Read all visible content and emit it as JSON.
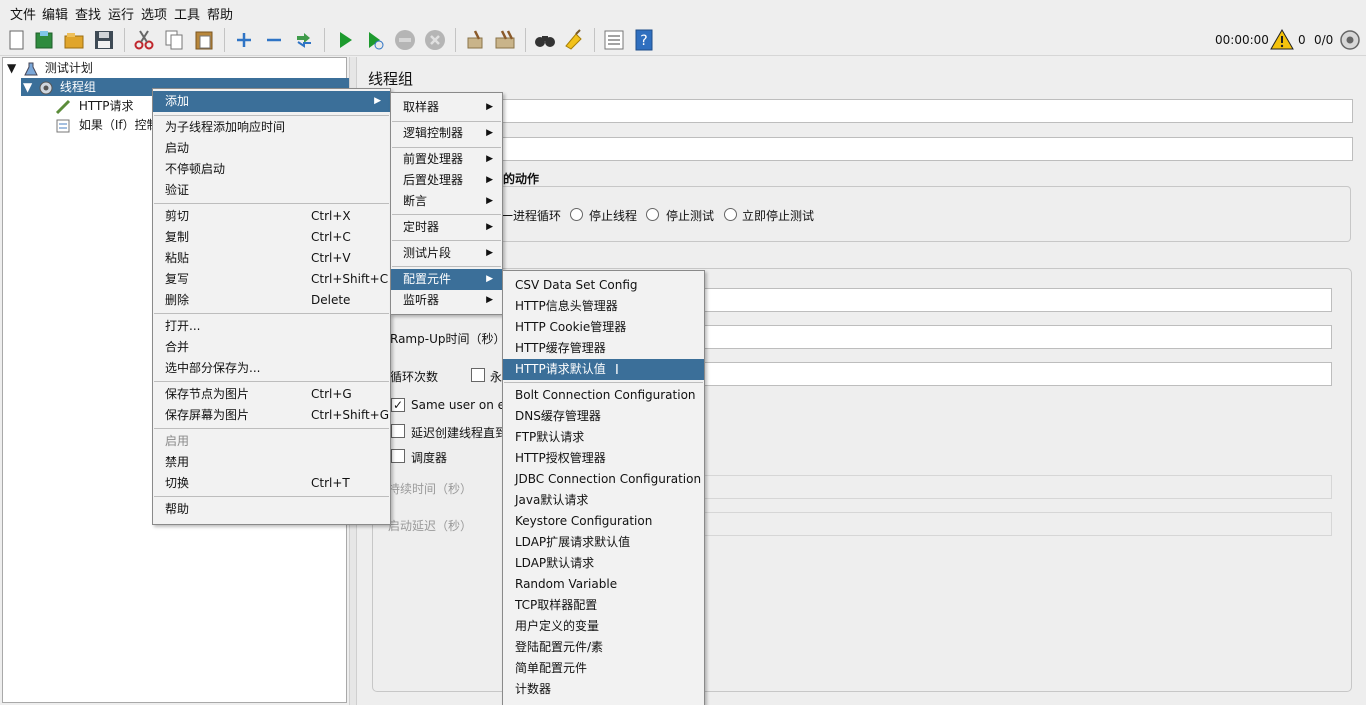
{
  "menubar": [
    "文件",
    "编辑",
    "查找",
    "运行",
    "选项",
    "工具",
    "帮助"
  ],
  "toolbar": {
    "icons": [
      "new-icon",
      "templates-icon",
      "open-icon",
      "save-icon",
      "cut-icon",
      "copy-icon",
      "paste-icon",
      "expand-icon",
      "collapse-icon",
      "toggle-icon",
      "start-icon",
      "start-no-pause-icon",
      "stop-icon",
      "shutdown-icon",
      "clear-icon",
      "clear-all-icon",
      "search-icon",
      "reset-search-icon",
      "function-helper-icon",
      "help-icon"
    ],
    "timer": "00:00:00",
    "warning_count": "0",
    "threads": "0/0",
    "accent": "#3b6f99"
  },
  "tree": {
    "root": "测试计划",
    "thread_group": "线程组",
    "children": [
      "HTTP请求",
      "如果（If）控制"
    ]
  },
  "panel": {
    "title": "线程组",
    "action_label": "的动作",
    "radio_options": [
      "一进程循环",
      "停止线程",
      "停止测试",
      "立即停止测试"
    ],
    "rampup_label": "Ramp-Up时间（秒）",
    "loop_label": "循环次数",
    "forever_label": "永",
    "same_user_label": "Same user on ea",
    "delay_label": "延迟创建线程直到",
    "scheduler_label": "调度器",
    "duration_label": "持续时间（秒）",
    "startup_delay_label": "启动延迟（秒）"
  },
  "context_menu": {
    "items": [
      {
        "label": "添加",
        "submenu": true
      },
      {
        "label": "为子线程添加响应时间"
      },
      {
        "label": "启动"
      },
      {
        "label": "不停顿启动"
      },
      {
        "label": "验证"
      },
      {
        "label": "剪切",
        "shortcut": "Ctrl+X"
      },
      {
        "label": "复制",
        "shortcut": "Ctrl+C"
      },
      {
        "label": "粘贴",
        "shortcut": "Ctrl+V"
      },
      {
        "label": "复写",
        "shortcut": "Ctrl+Shift+C"
      },
      {
        "label": "删除",
        "shortcut": "Delete"
      },
      {
        "label": "打开..."
      },
      {
        "label": "合并"
      },
      {
        "label": "选中部分保存为..."
      },
      {
        "label": "保存节点为图片",
        "shortcut": "Ctrl+G"
      },
      {
        "label": "保存屏幕为图片",
        "shortcut": "Ctrl+Shift+G"
      },
      {
        "label": "启用",
        "disabled": true
      },
      {
        "label": "禁用"
      },
      {
        "label": "切换",
        "shortcut": "Ctrl+T"
      },
      {
        "label": "帮助"
      }
    ]
  },
  "add_menu": {
    "items": [
      "取样器",
      "逻辑控制器",
      "前置处理器",
      "后置处理器",
      "断言",
      "定时器",
      "测试片段",
      "配置元件",
      "监听器"
    ]
  },
  "config_menu": {
    "items": [
      "CSV Data Set Config",
      "HTTP信息头管理器",
      "HTTP Cookie管理器",
      "HTTP缓存管理器",
      "HTTP请求默认值",
      "Bolt Connection Configuration",
      "DNS缓存管理器",
      "FTP默认请求",
      "HTTP授权管理器",
      "JDBC Connection Configuration",
      "Java默认请求",
      "Keystore Configuration",
      "LDAP扩展请求默认值",
      "LDAP默认请求",
      "Random Variable",
      "TCP取样器配置",
      "用户定义的变量",
      "登陆配置元件/素",
      "简单配置元件",
      "计数器"
    ]
  }
}
